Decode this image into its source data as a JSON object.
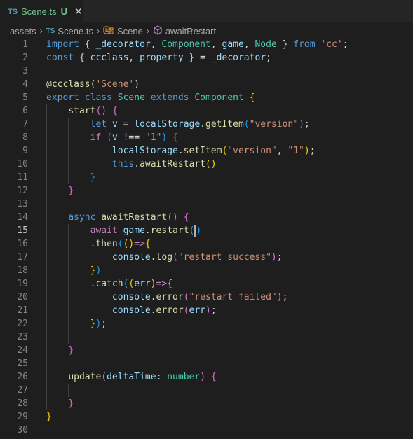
{
  "tab": {
    "lang_badge": "TS",
    "filename": "Scene.ts",
    "status": "U",
    "close_glyph": "✕"
  },
  "breadcrumb": {
    "folder": "assets",
    "file_badge": "TS",
    "file": "Scene.ts",
    "class": "Scene",
    "method": "awaitRestart",
    "sep": "›"
  },
  "editor": {
    "current_line": 15,
    "lines": [
      [
        [
          "kw",
          "import"
        ],
        [
          "p",
          " { "
        ],
        [
          "v",
          "_decorator"
        ],
        [
          "p",
          ", "
        ],
        [
          "t",
          "Component"
        ],
        [
          "p",
          ", "
        ],
        [
          "v",
          "game"
        ],
        [
          "p",
          ", "
        ],
        [
          "t",
          "Node"
        ],
        [
          "p",
          " } "
        ],
        [
          "kw",
          "from"
        ],
        [
          "p",
          " "
        ],
        [
          "s",
          "'cc'"
        ],
        [
          "p",
          ";"
        ]
      ],
      [
        [
          "kw",
          "const"
        ],
        [
          "p",
          " { "
        ],
        [
          "v",
          "ccclass"
        ],
        [
          "p",
          ", "
        ],
        [
          "v",
          "property"
        ],
        [
          "p",
          " } = "
        ],
        [
          "v",
          "_decorator"
        ],
        [
          "p",
          ";"
        ]
      ],
      [],
      [
        [
          "f",
          "@ccclass"
        ],
        [
          "p",
          "("
        ],
        [
          "s",
          "'Scene'"
        ],
        [
          "p",
          ")"
        ]
      ],
      [
        [
          "kw",
          "export"
        ],
        [
          "p",
          " "
        ],
        [
          "kw",
          "class"
        ],
        [
          "p",
          " "
        ],
        [
          "t",
          "Scene"
        ],
        [
          "p",
          " "
        ],
        [
          "kw",
          "extends"
        ],
        [
          "p",
          " "
        ],
        [
          "t",
          "Component"
        ],
        [
          "p",
          " "
        ],
        [
          "b1",
          "{"
        ]
      ],
      [
        [
          "p",
          "    "
        ],
        [
          "f",
          "start"
        ],
        [
          "b2",
          "()"
        ],
        [
          "p",
          " "
        ],
        [
          "b2",
          "{"
        ]
      ],
      [
        [
          "p",
          "        "
        ],
        [
          "kw",
          "let"
        ],
        [
          "p",
          " "
        ],
        [
          "v",
          "v"
        ],
        [
          "p",
          " = "
        ],
        [
          "v",
          "localStorage"
        ],
        [
          "p",
          "."
        ],
        [
          "f",
          "getItem"
        ],
        [
          "b3",
          "("
        ],
        [
          "s",
          "\"version\""
        ],
        [
          "b3",
          ")"
        ],
        [
          "p",
          ";"
        ]
      ],
      [
        [
          "p",
          "        "
        ],
        [
          "c",
          "if"
        ],
        [
          "p",
          " "
        ],
        [
          "b3",
          "("
        ],
        [
          "v",
          "v"
        ],
        [
          "p",
          " !== "
        ],
        [
          "s",
          "\"1\""
        ],
        [
          "b3",
          ")"
        ],
        [
          "p",
          " "
        ],
        [
          "b3",
          "{"
        ]
      ],
      [
        [
          "p",
          "            "
        ],
        [
          "v",
          "localStorage"
        ],
        [
          "p",
          "."
        ],
        [
          "f",
          "setItem"
        ],
        [
          "b1",
          "("
        ],
        [
          "s",
          "\"version\""
        ],
        [
          "p",
          ", "
        ],
        [
          "s",
          "\"1\""
        ],
        [
          "b1",
          ")"
        ],
        [
          "p",
          ";"
        ]
      ],
      [
        [
          "p",
          "            "
        ],
        [
          "kw",
          "this"
        ],
        [
          "p",
          "."
        ],
        [
          "f",
          "awaitRestart"
        ],
        [
          "b1",
          "()"
        ]
      ],
      [
        [
          "p",
          "        "
        ],
        [
          "b3",
          "}"
        ]
      ],
      [
        [
          "p",
          "    "
        ],
        [
          "b2",
          "}"
        ]
      ],
      [],
      [
        [
          "p",
          "    "
        ],
        [
          "kw",
          "async"
        ],
        [
          "p",
          " "
        ],
        [
          "f",
          "awaitRestart"
        ],
        [
          "b2",
          "()"
        ],
        [
          "p",
          " "
        ],
        [
          "b2",
          "{"
        ]
      ],
      [
        [
          "p",
          "        "
        ],
        [
          "c",
          "await"
        ],
        [
          "p",
          " "
        ],
        [
          "v",
          "game"
        ],
        [
          "p",
          "."
        ],
        [
          "f",
          "restart"
        ],
        [
          "b3",
          "("
        ],
        [
          "cur",
          ""
        ],
        [
          "b3",
          ")"
        ]
      ],
      [
        [
          "p",
          "        ."
        ],
        [
          "f",
          "then"
        ],
        [
          "b3",
          "("
        ],
        [
          "b1",
          "()"
        ],
        [
          "c",
          "=>"
        ],
        [
          "b1",
          "{"
        ]
      ],
      [
        [
          "p",
          "            "
        ],
        [
          "v",
          "console"
        ],
        [
          "p",
          "."
        ],
        [
          "f",
          "log"
        ],
        [
          "b2",
          "("
        ],
        [
          "s",
          "\"restart success\""
        ],
        [
          "b2",
          ")"
        ],
        [
          "p",
          ";"
        ]
      ],
      [
        [
          "p",
          "        "
        ],
        [
          "b1",
          "}"
        ],
        [
          "b3",
          ")"
        ]
      ],
      [
        [
          "p",
          "        ."
        ],
        [
          "f",
          "catch"
        ],
        [
          "b3",
          "("
        ],
        [
          "b1",
          "("
        ],
        [
          "v",
          "err"
        ],
        [
          "b1",
          ")"
        ],
        [
          "c",
          "=>"
        ],
        [
          "b1",
          "{"
        ]
      ],
      [
        [
          "p",
          "            "
        ],
        [
          "v",
          "console"
        ],
        [
          "p",
          "."
        ],
        [
          "f",
          "error"
        ],
        [
          "b2",
          "("
        ],
        [
          "s",
          "\"restart failed\""
        ],
        [
          "b2",
          ")"
        ],
        [
          "p",
          ";"
        ]
      ],
      [
        [
          "p",
          "            "
        ],
        [
          "v",
          "console"
        ],
        [
          "p",
          "."
        ],
        [
          "f",
          "error"
        ],
        [
          "b2",
          "("
        ],
        [
          "v",
          "err"
        ],
        [
          "b2",
          ")"
        ],
        [
          "p",
          ";"
        ]
      ],
      [
        [
          "p",
          "        "
        ],
        [
          "b1",
          "}"
        ],
        [
          "b3",
          ")"
        ],
        [
          "p",
          ";"
        ]
      ],
      [],
      [
        [
          "p",
          "    "
        ],
        [
          "b2",
          "}"
        ]
      ],
      [],
      [
        [
          "p",
          "    "
        ],
        [
          "f",
          "update"
        ],
        [
          "b2",
          "("
        ],
        [
          "v",
          "deltaTime"
        ],
        [
          "p",
          ": "
        ],
        [
          "t",
          "number"
        ],
        [
          "b2",
          ")"
        ],
        [
          "p",
          " "
        ],
        [
          "b2",
          "{"
        ]
      ],
      [],
      [
        [
          "p",
          "    "
        ],
        [
          "b2",
          "}"
        ]
      ],
      [
        [
          "b1",
          "}"
        ]
      ],
      []
    ],
    "colors": {
      "kw": "#569cd6",
      "c": "#c586c0",
      "v": "#9cdcfe",
      "t": "#4ec9b0",
      "f": "#dcdcaa",
      "s": "#ce9178",
      "p": "#d4d4d4",
      "b1": "#ffd700",
      "b2": "#da70d6",
      "b3": "#179fff"
    }
  }
}
